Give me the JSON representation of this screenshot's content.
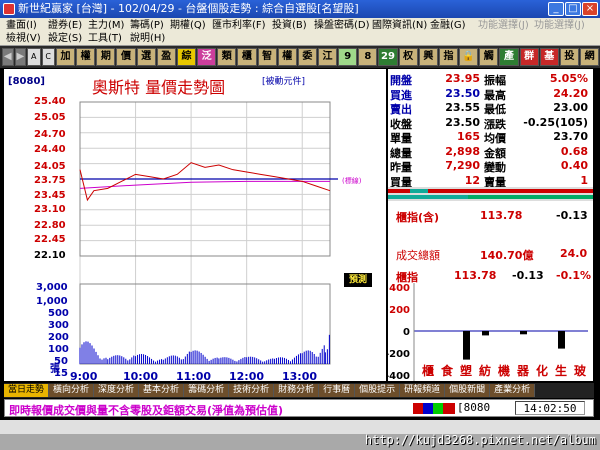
{
  "window": {
    "title": "新世紀贏家 [台灣] - 102/04/29 - 台盤個股走勢 : 綜合自選股[名望股]",
    "min": "_",
    "max": "□",
    "close": "×"
  },
  "menu": {
    "row1": [
      "畫面(I)",
      "證券(E)",
      "主力(M)",
      "籌碼(P)",
      "期權(Q)",
      "匯市利率(F)",
      "投資(B)",
      "操盤密碼(D)",
      "國際資訊(N)",
      "金融(G)",
      "功能選擇(J)",
      "功能選擇(J)"
    ],
    "row2": [
      "檢視(V)",
      "設定(S)",
      "工具(T)",
      "說明(H)"
    ]
  },
  "toolbar": {
    "letters": [
      "A",
      "C"
    ],
    "tabs": [
      {
        "t": "加",
        "c": "tan"
      },
      {
        "t": "權",
        "c": "tan"
      },
      {
        "t": "期",
        "c": "tan"
      },
      {
        "t": "價",
        "c": "tan"
      },
      {
        "t": "選",
        "c": "tan"
      },
      {
        "t": "盈",
        "c": "tan"
      },
      {
        "t": "綜",
        "c": "yellow"
      },
      {
        "t": "泛",
        "c": "pink"
      },
      {
        "t": "類",
        "c": "tan"
      },
      {
        "t": "櫃",
        "c": "tan"
      },
      {
        "t": "智",
        "c": "tan"
      },
      {
        "t": "權",
        "c": "tan"
      },
      {
        "t": "委",
        "c": "tan"
      },
      {
        "t": "江",
        "c": "tan"
      },
      {
        "t": "9",
        "c": "lgreen"
      },
      {
        "t": "8",
        "c": "tan"
      },
      {
        "t": "29",
        "c": "green"
      },
      {
        "t": "权",
        "c": "tan"
      },
      {
        "t": "興",
        "c": "tan"
      },
      {
        "t": "指",
        "c": "tan"
      },
      {
        "t": "🔒",
        "c": "tan"
      },
      {
        "t": "觸",
        "c": "tan"
      },
      {
        "t": "產",
        "c": "green"
      },
      {
        "t": "群",
        "c": "red"
      },
      {
        "t": "基",
        "c": "red"
      },
      {
        "t": "投",
        "c": "tan"
      },
      {
        "t": "網",
        "c": "tan"
      }
    ]
  },
  "chart": {
    "symbol": "[8080]",
    "title": "奧斯特  量價走勢圖",
    "mode": "[被動元件]",
    "ref_label": "(標線)"
  },
  "chart_data": {
    "type": "line",
    "title": "奧斯特  量價走勢圖",
    "price_ticks": [
      "25.40",
      "25.05",
      "24.70",
      "24.40",
      "24.05",
      "23.75",
      "23.45",
      "23.10",
      "22.80",
      "22.45",
      "22.10"
    ],
    "volume_ticks": [
      "3,000",
      "1,000",
      "500",
      "300",
      "200",
      "100",
      "50",
      "15",
      "張"
    ],
    "x_ticks": [
      "9:00",
      "10:00",
      "11:00",
      "12:00",
      "13:00"
    ],
    "ref_price": 23.75,
    "ylim": [
      22.1,
      25.4
    ],
    "price_series": {
      "x": [
        "9:00",
        "9:08",
        "9:15",
        "9:30",
        "9:45",
        "10:00",
        "10:15",
        "10:30",
        "10:45",
        "11:00",
        "11:15",
        "11:30",
        "11:45",
        "12:00",
        "12:15",
        "12:30",
        "12:45",
        "13:00",
        "13:15",
        "13:30"
      ],
      "y": [
        23.95,
        23.3,
        23.5,
        23.55,
        23.7,
        23.85,
        23.8,
        23.75,
        23.85,
        24.1,
        24.0,
        24.05,
        23.95,
        23.9,
        23.85,
        23.8,
        23.75,
        23.7,
        23.6,
        23.5
      ]
    },
    "avg_series": {
      "x": [
        "9:00",
        "10:00",
        "11:00",
        "12:00",
        "13:00",
        "13:30"
      ],
      "y": [
        23.55,
        23.62,
        23.68,
        23.7,
        23.7,
        23.7
      ]
    },
    "volume_series": {
      "x": [
        "9:00",
        "9:30",
        "10:00",
        "10:30",
        "11:00",
        "11:30",
        "12:00",
        "12:30",
        "13:00",
        "13:25",
        "13:30"
      ],
      "y": [
        150,
        40,
        60,
        30,
        80,
        35,
        40,
        30,
        60,
        120,
        380
      ]
    }
  },
  "predict_label": "預測",
  "quote": {
    "rows": [
      [
        {
          "l": "開盤",
          "v": "23.95",
          "c": "red"
        },
        {
          "l": "振幅",
          "v": "5.05%",
          "c": "red"
        }
      ],
      [
        {
          "l": "買進",
          "v": "23.50",
          "c": "blue"
        },
        {
          "l": "最高",
          "v": "24.20",
          "c": "red"
        }
      ],
      [
        {
          "l": "賣出",
          "v": "23.55",
          "c": "blk"
        },
        {
          "l": "最低",
          "v": "23.00",
          "c": "blk"
        }
      ],
      [
        {
          "l": "收盤",
          "v": "23.50",
          "c": "blk"
        },
        {
          "l": "漲跌",
          "v": "-0.25(105)",
          "c": "blk"
        }
      ],
      [
        {
          "l": "單量",
          "v": "165",
          "c": "red"
        },
        {
          "l": "均價",
          "v": "23.70",
          "c": "blk"
        }
      ],
      [
        {
          "l": "總量",
          "v": "2,898",
          "c": "red"
        },
        {
          "l": "金額",
          "v": "0.68",
          "c": "red"
        }
      ],
      [
        {
          "l": "昨量",
          "v": "7,290",
          "c": "red"
        },
        {
          "l": "變動",
          "v": "0.40",
          "c": "red"
        }
      ],
      [
        {
          "l": "買量",
          "v": "12",
          "c": "red"
        },
        {
          "l": "賣量",
          "v": "1",
          "c": "red"
        }
      ]
    ]
  },
  "index": {
    "label": "櫃指(含)",
    "value": "113.78",
    "change": "-0.13",
    "turnover_label": "成交總額",
    "turnover": "140.70億",
    "turnover2": "24.0"
  },
  "sector": {
    "label": "櫃指",
    "value": "113.78",
    "change": "-0.13",
    "pct": "-0.1%",
    "ticks": [
      "+400",
      "+200",
      "0",
      "-200",
      "-400"
    ],
    "categories": [
      "櫃",
      "食",
      "塑",
      "紡",
      "機",
      "器",
      "化",
      "生",
      "玻"
    ],
    "values": [
      0,
      0,
      -260,
      -40,
      0,
      -30,
      0,
      -160,
      0
    ]
  },
  "tabs": [
    "當日走勢",
    "橫向分析",
    "深度分析",
    "基本分析",
    "籌碼分析",
    "技術分析",
    "財務分析",
    "行事曆",
    "個股提示",
    "研報頻道",
    "個股新聞",
    "產業分析"
  ],
  "status": {
    "message": "即時報價成交價與量不含零股及鉅額交易(淨值為預估值)",
    "code": "8080",
    "time": "14:02:50"
  },
  "footer_url": "http://kujd3268.pixnet.net/album"
}
